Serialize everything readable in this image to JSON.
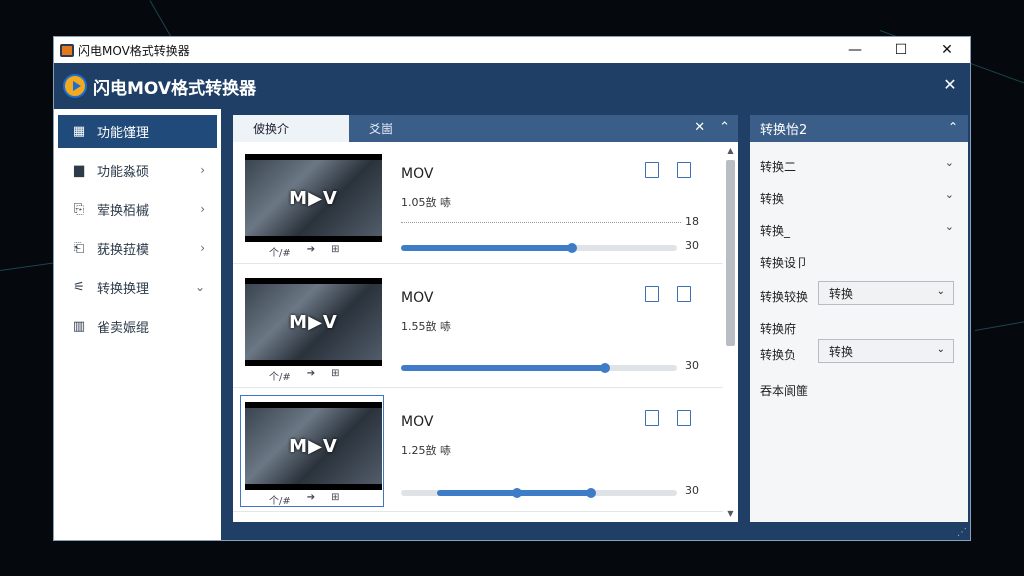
{
  "window": {
    "title": "闪电MOV格式转换器",
    "minimize": "—",
    "maximize": "☐",
    "close": "✕"
  },
  "header": {
    "app_name": "闪电MOV格式转换器",
    "close": "✕"
  },
  "sidebar": {
    "items": [
      {
        "label": "功能馑理",
        "icon": "grid-icon",
        "glyph": "▦",
        "chevron": ""
      },
      {
        "label": "功能淼硕",
        "icon": "document-icon",
        "glyph": "▆",
        "chevron": "›"
      },
      {
        "label": "荤换栢槭",
        "icon": "file-download-icon",
        "glyph": "⎘",
        "chevron": "›"
      },
      {
        "label": "莸换菈模",
        "icon": "file-icon",
        "glyph": "⎗",
        "chevron": "›"
      },
      {
        "label": "转换换理",
        "icon": "tools-icon",
        "glyph": "⚟",
        "chevron": "⌄"
      },
      {
        "label": "雀卖娠绲",
        "icon": "calendar-icon",
        "glyph": "▥",
        "chevron": ""
      }
    ]
  },
  "tabs": {
    "tab1": "佊换介",
    "tab2": "爻崮",
    "tools_icon": "✕",
    "collapse_icon": "⌃"
  },
  "files": [
    {
      "name": "MOV",
      "size": "1.05敨 哧",
      "thumb_text": "M▶V",
      "dots_value": "18",
      "bar_value": "30",
      "progress": 0.62,
      "range_start": null
    },
    {
      "name": "MOV",
      "size": "1.55敨 哧",
      "thumb_text": "M▶V",
      "dots_value": null,
      "bar_value": "30",
      "progress": 0.74,
      "range_start": null
    },
    {
      "name": "MOV",
      "size": "1.25敨 哧",
      "thumb_text": "M▶V",
      "dots_value": null,
      "bar_value": "30",
      "progress": 0.69,
      "range_start": 0.42
    }
  ],
  "thumb_controls": {
    "a": "个/#",
    "b": "➔",
    "c": "⊞"
  },
  "right_panel": {
    "title": "转换怡2",
    "rows": [
      {
        "label": "转换二",
        "chev": "⌄"
      },
      {
        "label": "转换",
        "chev": "⌄"
      },
      {
        "label": "转换_",
        "chev": "⌄"
      }
    ],
    "section1": "转换设卩",
    "field1_label": "转换较换",
    "field1_value": "转换",
    "section2": "转换府",
    "field2_label": "转换负",
    "field2_value": "转换",
    "footer": "吞本阆篚"
  }
}
